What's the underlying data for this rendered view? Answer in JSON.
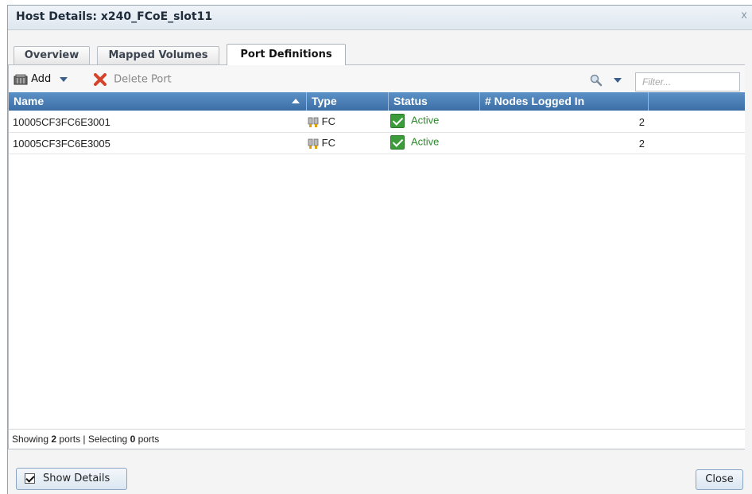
{
  "dialog": {
    "title": "Host Details: x240_FCoE_slot11",
    "close_glyph": "x"
  },
  "tabs": [
    {
      "label": "Overview",
      "active": false
    },
    {
      "label": "Mapped Volumes",
      "active": false
    },
    {
      "label": "Port Definitions",
      "active": true
    }
  ],
  "toolbar": {
    "add_label": "Add",
    "delete_label": "Delete Port",
    "filter_placeholder": "Filter..."
  },
  "grid": {
    "columns": [
      "Name",
      "Type",
      "Status",
      "# Nodes Logged In"
    ],
    "sort_column": "Name",
    "sort_direction": "ascending",
    "rows": [
      {
        "name": "10005CF3FC6E3001",
        "type": "FC",
        "status": "Active",
        "nodes": "2"
      },
      {
        "name": "10005CF3FC6E3005",
        "type": "FC",
        "status": "Active",
        "nodes": "2"
      }
    ]
  },
  "footer": {
    "showing_prefix": "Showing ",
    "showing_count": "2",
    "showing_mid": " ports | Selecting ",
    "selecting_count": "0",
    "selecting_suffix": " ports"
  },
  "buttons": {
    "show_details_label": "Show Details",
    "show_details_checked": true,
    "close_label": "Close"
  },
  "colors": {
    "header_blue": "#4a7fb6",
    "status_green": "#2f8a2f"
  }
}
